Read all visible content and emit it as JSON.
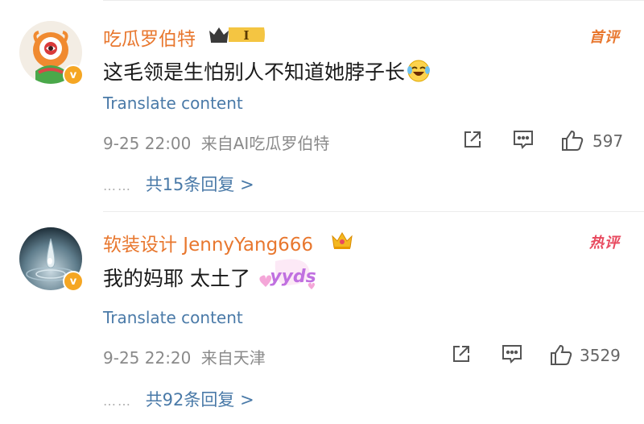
{
  "comments": [
    {
      "username": "吃瓜罗伯特",
      "badge_level": "I",
      "tag": "首评",
      "text": "这毛领是生怕别人不知道她脖子长",
      "text_emoji": "laughing-tears-icon",
      "translate": "Translate content",
      "timestamp": "9-25 22:00",
      "source": "来自AI吃瓜罗伯特",
      "likes": "597",
      "replies_dots": "……",
      "replies_link": "共15条回复 >"
    },
    {
      "username": "软装设计 JennyYang666",
      "badge": "crown-icon",
      "tag": "热评",
      "text": "我的妈耶 太土了",
      "sticker": "yyds",
      "translate": "Translate content",
      "timestamp": "9-25 22:20",
      "source": "来自天津",
      "likes": "3529",
      "replies_dots": "……",
      "replies_link": "共92条回复 >"
    }
  ],
  "colors": {
    "username": "#e8772e",
    "link": "#4a7aa8",
    "meta": "#8a8a8a",
    "hot": "#e84a5f",
    "verified": "#f5a623"
  }
}
